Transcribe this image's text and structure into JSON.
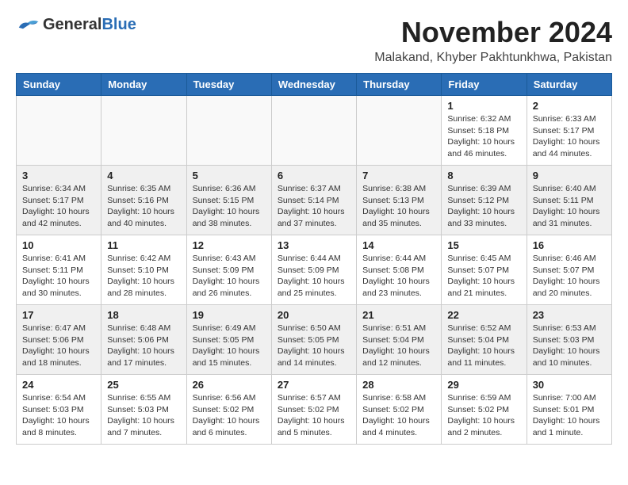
{
  "header": {
    "logo_general": "General",
    "logo_blue": "Blue",
    "month_year": "November 2024",
    "location": "Malakand, Khyber Pakhtunkhwa, Pakistan"
  },
  "days_of_week": [
    "Sunday",
    "Monday",
    "Tuesday",
    "Wednesday",
    "Thursday",
    "Friday",
    "Saturday"
  ],
  "weeks": [
    {
      "shade": false,
      "days": [
        {
          "num": "",
          "info": ""
        },
        {
          "num": "",
          "info": ""
        },
        {
          "num": "",
          "info": ""
        },
        {
          "num": "",
          "info": ""
        },
        {
          "num": "",
          "info": ""
        },
        {
          "num": "1",
          "info": "Sunrise: 6:32 AM\nSunset: 5:18 PM\nDaylight: 10 hours\nand 46 minutes."
        },
        {
          "num": "2",
          "info": "Sunrise: 6:33 AM\nSunset: 5:17 PM\nDaylight: 10 hours\nand 44 minutes."
        }
      ]
    },
    {
      "shade": true,
      "days": [
        {
          "num": "3",
          "info": "Sunrise: 6:34 AM\nSunset: 5:17 PM\nDaylight: 10 hours\nand 42 minutes."
        },
        {
          "num": "4",
          "info": "Sunrise: 6:35 AM\nSunset: 5:16 PM\nDaylight: 10 hours\nand 40 minutes."
        },
        {
          "num": "5",
          "info": "Sunrise: 6:36 AM\nSunset: 5:15 PM\nDaylight: 10 hours\nand 38 minutes."
        },
        {
          "num": "6",
          "info": "Sunrise: 6:37 AM\nSunset: 5:14 PM\nDaylight: 10 hours\nand 37 minutes."
        },
        {
          "num": "7",
          "info": "Sunrise: 6:38 AM\nSunset: 5:13 PM\nDaylight: 10 hours\nand 35 minutes."
        },
        {
          "num": "8",
          "info": "Sunrise: 6:39 AM\nSunset: 5:12 PM\nDaylight: 10 hours\nand 33 minutes."
        },
        {
          "num": "9",
          "info": "Sunrise: 6:40 AM\nSunset: 5:11 PM\nDaylight: 10 hours\nand 31 minutes."
        }
      ]
    },
    {
      "shade": false,
      "days": [
        {
          "num": "10",
          "info": "Sunrise: 6:41 AM\nSunset: 5:11 PM\nDaylight: 10 hours\nand 30 minutes."
        },
        {
          "num": "11",
          "info": "Sunrise: 6:42 AM\nSunset: 5:10 PM\nDaylight: 10 hours\nand 28 minutes."
        },
        {
          "num": "12",
          "info": "Sunrise: 6:43 AM\nSunset: 5:09 PM\nDaylight: 10 hours\nand 26 minutes."
        },
        {
          "num": "13",
          "info": "Sunrise: 6:44 AM\nSunset: 5:09 PM\nDaylight: 10 hours\nand 25 minutes."
        },
        {
          "num": "14",
          "info": "Sunrise: 6:44 AM\nSunset: 5:08 PM\nDaylight: 10 hours\nand 23 minutes."
        },
        {
          "num": "15",
          "info": "Sunrise: 6:45 AM\nSunset: 5:07 PM\nDaylight: 10 hours\nand 21 minutes."
        },
        {
          "num": "16",
          "info": "Sunrise: 6:46 AM\nSunset: 5:07 PM\nDaylight: 10 hours\nand 20 minutes."
        }
      ]
    },
    {
      "shade": true,
      "days": [
        {
          "num": "17",
          "info": "Sunrise: 6:47 AM\nSunset: 5:06 PM\nDaylight: 10 hours\nand 18 minutes."
        },
        {
          "num": "18",
          "info": "Sunrise: 6:48 AM\nSunset: 5:06 PM\nDaylight: 10 hours\nand 17 minutes."
        },
        {
          "num": "19",
          "info": "Sunrise: 6:49 AM\nSunset: 5:05 PM\nDaylight: 10 hours\nand 15 minutes."
        },
        {
          "num": "20",
          "info": "Sunrise: 6:50 AM\nSunset: 5:05 PM\nDaylight: 10 hours\nand 14 minutes."
        },
        {
          "num": "21",
          "info": "Sunrise: 6:51 AM\nSunset: 5:04 PM\nDaylight: 10 hours\nand 12 minutes."
        },
        {
          "num": "22",
          "info": "Sunrise: 6:52 AM\nSunset: 5:04 PM\nDaylight: 10 hours\nand 11 minutes."
        },
        {
          "num": "23",
          "info": "Sunrise: 6:53 AM\nSunset: 5:03 PM\nDaylight: 10 hours\nand 10 minutes."
        }
      ]
    },
    {
      "shade": false,
      "days": [
        {
          "num": "24",
          "info": "Sunrise: 6:54 AM\nSunset: 5:03 PM\nDaylight: 10 hours\nand 8 minutes."
        },
        {
          "num": "25",
          "info": "Sunrise: 6:55 AM\nSunset: 5:03 PM\nDaylight: 10 hours\nand 7 minutes."
        },
        {
          "num": "26",
          "info": "Sunrise: 6:56 AM\nSunset: 5:02 PM\nDaylight: 10 hours\nand 6 minutes."
        },
        {
          "num": "27",
          "info": "Sunrise: 6:57 AM\nSunset: 5:02 PM\nDaylight: 10 hours\nand 5 minutes."
        },
        {
          "num": "28",
          "info": "Sunrise: 6:58 AM\nSunset: 5:02 PM\nDaylight: 10 hours\nand 4 minutes."
        },
        {
          "num": "29",
          "info": "Sunrise: 6:59 AM\nSunset: 5:02 PM\nDaylight: 10 hours\nand 2 minutes."
        },
        {
          "num": "30",
          "info": "Sunrise: 7:00 AM\nSunset: 5:01 PM\nDaylight: 10 hours\nand 1 minute."
        }
      ]
    }
  ]
}
